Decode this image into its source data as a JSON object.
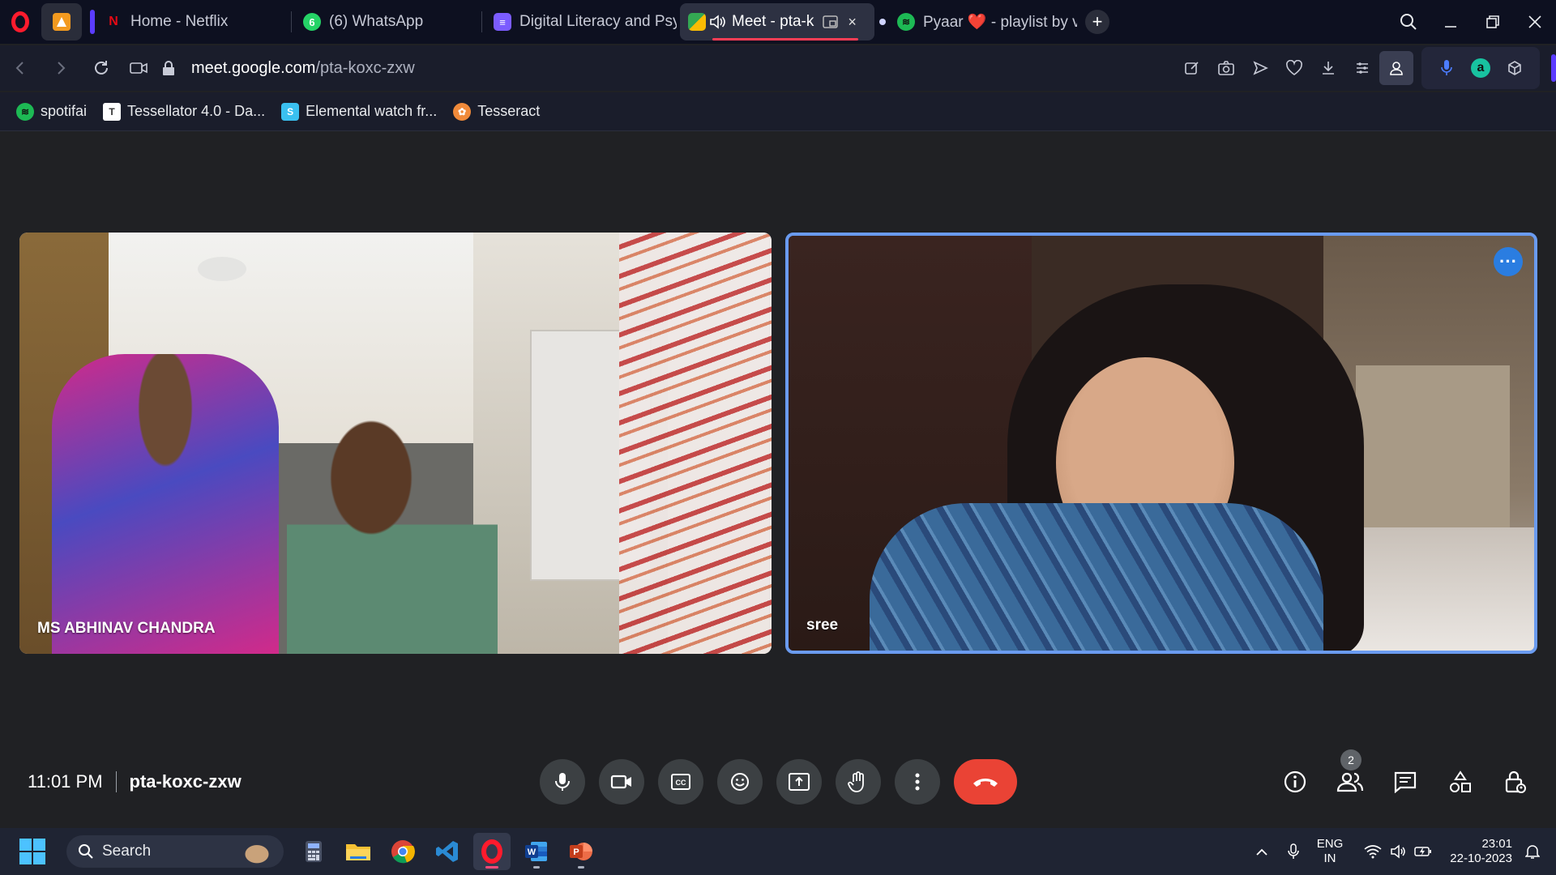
{
  "browser": {
    "tabs": [
      {
        "label": "Home - Netflix",
        "icon": "netflix-icon"
      },
      {
        "label": "(6) WhatsApp",
        "icon": "whatsapp-icon"
      },
      {
        "label": "Digital Literacy and Psyc",
        "icon": "document-icon"
      },
      {
        "label": "Meet - pta-k",
        "icon": "meet-icon",
        "active": true
      },
      {
        "label": "Pyaar ❤️ - playlist by vi",
        "icon": "spotify-icon"
      }
    ],
    "url_host": "meet.google.com",
    "url_path": "/pta-koxc-zxw"
  },
  "bookmarks": [
    {
      "label": "spotifai",
      "icon": "spotify-icon",
      "color": "#1db954"
    },
    {
      "label": "Tessellator 4.0 - Da...",
      "icon": "tessellator-icon",
      "color": "#ffffff"
    },
    {
      "label": "Elemental watch fr...",
      "icon": "elemental-icon",
      "color": "#3ac0f0"
    },
    {
      "label": "Tesseract",
      "icon": "tesseract-icon",
      "color": "#f08a3a"
    }
  ],
  "meet": {
    "participants": [
      {
        "name": "MS ABHINAV CHANDRA"
      },
      {
        "name": "sree"
      }
    ],
    "time": "11:01 PM",
    "meeting_code": "pta-koxc-zxw",
    "people_count": "2",
    "colors": {
      "end_call": "#ea4335",
      "speaking_border": "#6a9bf0",
      "control_bg": "#3c4043"
    }
  },
  "taskbar": {
    "search_placeholder": "Search",
    "language_top": "ENG",
    "language_bottom": "IN",
    "clock_time": "23:01",
    "clock_date": "22-10-2023"
  }
}
